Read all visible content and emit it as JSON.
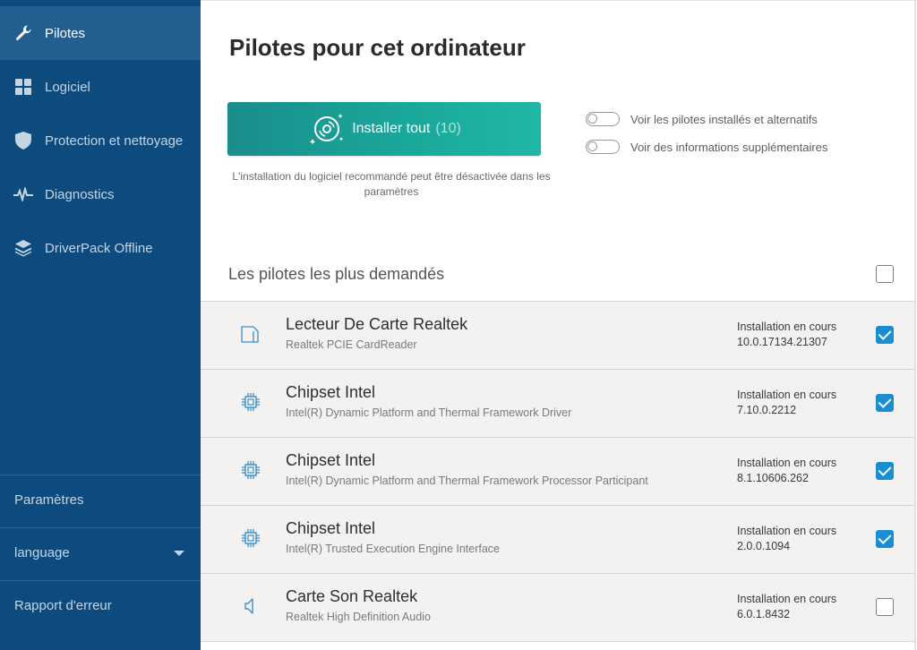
{
  "sidebar": {
    "items": [
      {
        "label": "Pilotes",
        "icon": "wrench-icon",
        "active": true
      },
      {
        "label": "Logiciel",
        "icon": "grid-icon",
        "active": false
      },
      {
        "label": "Protection et nettoyage",
        "icon": "shield-icon",
        "active": false
      },
      {
        "label": "Diagnostics",
        "icon": "pulse-icon",
        "active": false
      },
      {
        "label": "DriverPack Offline",
        "icon": "layers-icon",
        "active": false
      }
    ],
    "settings_label": "Paramètres",
    "language_label": "language",
    "error_report_label": "Rapport d'erreur"
  },
  "main": {
    "title": "Pilotes pour cet ordinateur",
    "install_button": {
      "label": "Installer tout",
      "count": "(10)"
    },
    "install_note": "L'installation du logiciel recommandé peut être désactivée dans les paramètres",
    "toggles": [
      {
        "label": "Voir les pilotes installés et alternatifs",
        "on": false
      },
      {
        "label": "Voir des informations supplémentaires",
        "on": false
      }
    ],
    "section_title": "Les pilotes les plus demandés",
    "drivers": [
      {
        "name": "Lecteur De Carte Realtek",
        "sub": "Realtek PCIE CardReader",
        "status": "Installation en cours",
        "version": "10.0.17134.21307",
        "checked": true,
        "icon": "card-reader-icon"
      },
      {
        "name": "Chipset Intel",
        "sub": "Intel(R) Dynamic Platform and Thermal Framework Driver",
        "status": "Installation en cours",
        "version": "7.10.0.2212",
        "checked": true,
        "icon": "chip-icon"
      },
      {
        "name": "Chipset Intel",
        "sub": "Intel(R) Dynamic Platform and Thermal Framework Processor Participant",
        "status": "Installation en cours",
        "version": "8.1.10606.262",
        "checked": true,
        "icon": "chip-icon"
      },
      {
        "name": "Chipset Intel",
        "sub": "Intel(R) Trusted Execution Engine Interface",
        "status": "Installation en cours",
        "version": "2.0.0.1094",
        "checked": true,
        "icon": "chip-icon"
      },
      {
        "name": "Carte Son Realtek",
        "sub": "Realtek High Definition Audio",
        "status": "Installation en cours",
        "version": "6.0.1.8432",
        "checked": false,
        "icon": "speaker-icon"
      }
    ]
  },
  "colors": {
    "sidebar_bg": "#0d4a7e",
    "sidebar_active": "#235e91",
    "accent_teal": "#1aa99c",
    "checkbox_blue": "#1a8ed0"
  }
}
